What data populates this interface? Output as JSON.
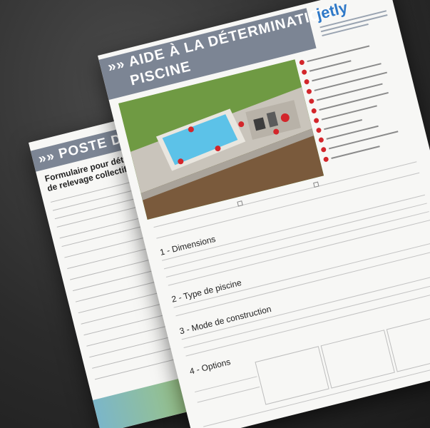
{
  "back_sheet": {
    "header": "»» POSTE DE RE",
    "subtitle_line1": "Formulaire pour déterm",
    "subtitle_line2": "de relevage collectif"
  },
  "front_sheet": {
    "title_line1": "»» AIDE À LA DÉTERMINATION",
    "title_line2": "PISCINE",
    "logo_text": "jetly",
    "legend_count": 11,
    "sections": [
      {
        "label": "1 - Dimensions"
      },
      {
        "label": "2 - Type de piscine"
      },
      {
        "label": "3 - Mode de construction"
      },
      {
        "label": "4 - Options"
      }
    ]
  },
  "colors": {
    "background": "#2b2b2b",
    "header_bar": "#7c8594",
    "legend_dot": "#d3262b",
    "logo": "#2f79c8",
    "pool_water": "#5cc2e8",
    "grass": "#6f9a43"
  }
}
